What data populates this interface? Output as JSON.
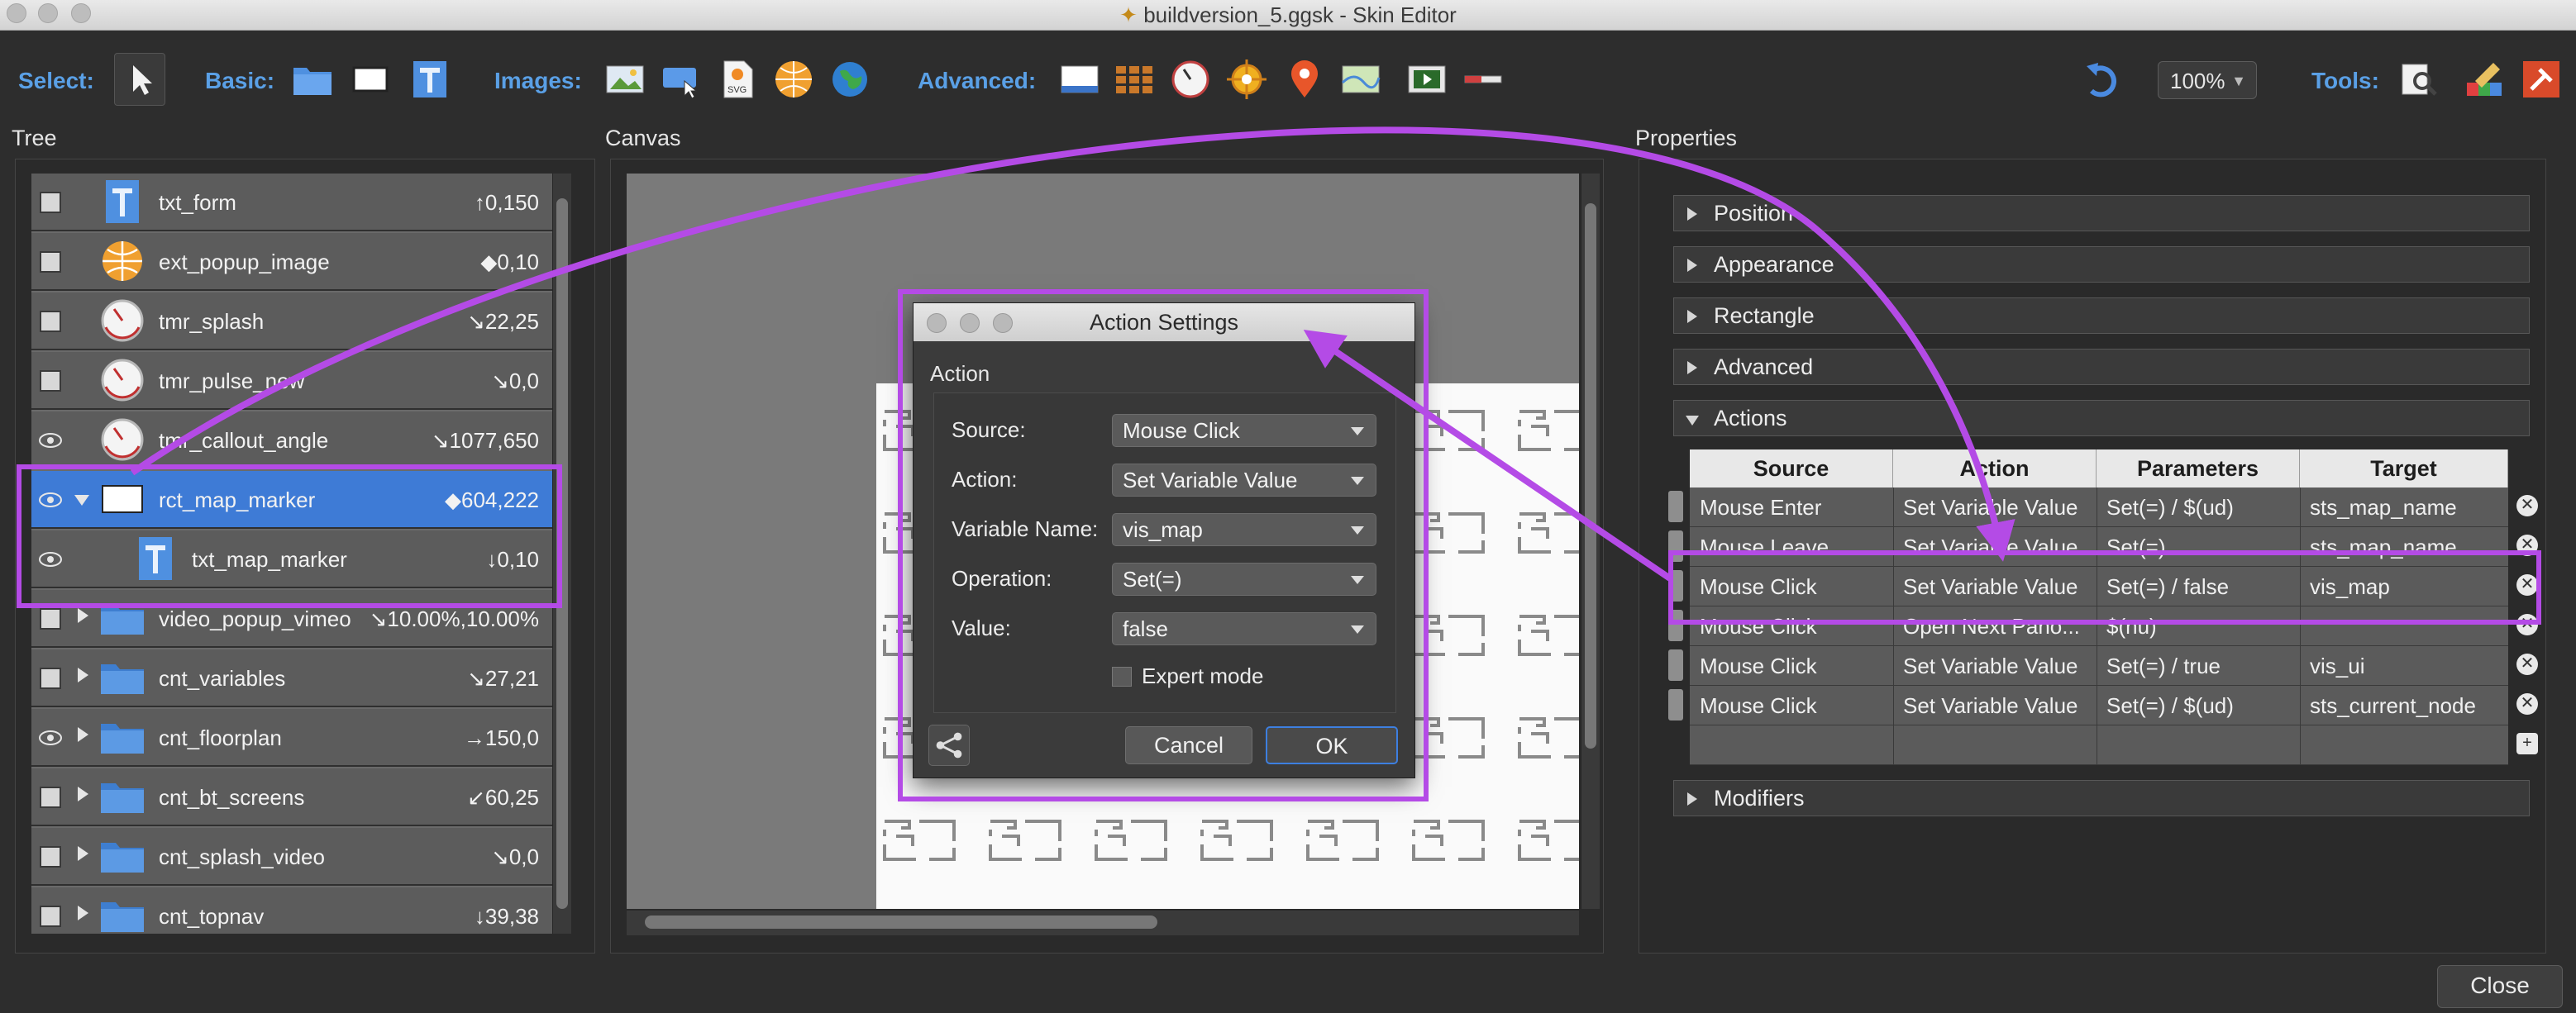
{
  "window": {
    "title": "buildversion_5.ggsk - Skin Editor"
  },
  "toolbar": {
    "select_label": "Select:",
    "basic_label": "Basic:",
    "images_label": "Images:",
    "advanced_label": "Advanced:",
    "tools_label": "Tools:",
    "zoom_value": "100%"
  },
  "panels": {
    "tree": "Tree",
    "canvas": "Canvas",
    "properties": "Properties"
  },
  "tree": {
    "rows": [
      {
        "name": "txt_form",
        "value": "↑0,150",
        "icon": "text-icon",
        "visible": false,
        "expander": "none",
        "indent": 0
      },
      {
        "name": "ext_popup_image",
        "value": "◆0,10",
        "icon": "globe-image-icon",
        "visible": false,
        "expander": "none",
        "indent": 0
      },
      {
        "name": "tmr_splash",
        "value": "↘22,25",
        "icon": "timer-icon",
        "visible": false,
        "expander": "none",
        "indent": 0
      },
      {
        "name": "tmr_pulse_new",
        "value": "↘0,0",
        "icon": "timer-icon",
        "visible": false,
        "expander": "none",
        "indent": 0
      },
      {
        "name": "tmr_callout_angle",
        "value": "↘1077,650",
        "icon": "timer-icon",
        "visible": true,
        "expander": "none",
        "indent": 0
      },
      {
        "name": "rct_map_marker",
        "value": "◆604,222",
        "icon": "rectangle-icon",
        "visible": true,
        "expander": "open",
        "indent": 0,
        "selected": true
      },
      {
        "name": "txt_map_marker",
        "value": "↓0,10",
        "icon": "text-icon",
        "visible": true,
        "expander": "none",
        "indent": 1
      },
      {
        "name": "video_popup_vimeo",
        "value": "↘10.00%,10.00%",
        "icon": "folder-icon",
        "visible": false,
        "expander": "closed",
        "indent": 0
      },
      {
        "name": "cnt_variables",
        "value": "↘27,21",
        "icon": "folder-icon",
        "visible": false,
        "expander": "closed",
        "indent": 0
      },
      {
        "name": "cnt_floorplan",
        "value": "→150,0",
        "icon": "folder-icon",
        "visible": true,
        "expander": "closed",
        "indent": 0
      },
      {
        "name": "cnt_bt_screens",
        "value": "↙60,25",
        "icon": "folder-icon",
        "visible": false,
        "expander": "closed",
        "indent": 0
      },
      {
        "name": "cnt_splash_video",
        "value": "↘0,0",
        "icon": "folder-icon",
        "visible": false,
        "expander": "closed",
        "indent": 0
      },
      {
        "name": "cnt_topnav",
        "value": "↓39,38",
        "icon": "folder-icon",
        "visible": false,
        "expander": "closed",
        "indent": 0
      }
    ]
  },
  "properties": {
    "sections": {
      "position": "Position",
      "appearance": "Appearance",
      "rectangle": "Rectangle",
      "advanced": "Advanced",
      "actions": "Actions",
      "modifiers": "Modifiers"
    },
    "actions_table": {
      "headers": [
        "Source",
        "Action",
        "Parameters",
        "Target"
      ],
      "rows": [
        [
          "Mouse Enter",
          "Set Variable Value",
          "Set(=) / $(ud)",
          "sts_map_name"
        ],
        [
          "Mouse Leave",
          "Set Variable Value",
          "Set(=)",
          "sts_map_name"
        ],
        [
          "Mouse Click",
          "Set Variable Value",
          "Set(=) / false",
          "vis_map"
        ],
        [
          "Mouse Click",
          "Open Next Pano...",
          "$(nu)",
          ""
        ],
        [
          "Mouse Click",
          "Set Variable Value",
          "Set(=) / true",
          "vis_ui"
        ],
        [
          "Mouse Click",
          "Set Variable Value",
          "Set(=) / $(ud)",
          "sts_current_node"
        ]
      ]
    }
  },
  "dialog": {
    "title": "Action Settings",
    "section": "Action",
    "fields": {
      "source_label": "Source:",
      "source_value": "Mouse Click",
      "action_label": "Action:",
      "action_value": "Set Variable Value",
      "varname_label": "Variable Name:",
      "varname_value": "vis_map",
      "operation_label": "Operation:",
      "operation_value": "Set(=)",
      "value_label": "Value:",
      "value_value": "false"
    },
    "expert_mode_label": "Expert mode",
    "cancel_label": "Cancel",
    "ok_label": "OK"
  },
  "footer": {
    "close_label": "Close"
  },
  "colors": {
    "accent": "#3e7bd6",
    "highlight": "#b44be6",
    "label_blue": "#5aa0e6"
  }
}
